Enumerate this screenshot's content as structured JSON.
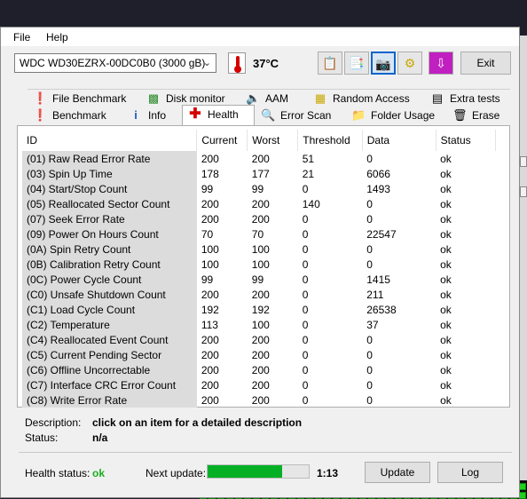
{
  "menu": {
    "file": "File",
    "help": "Help"
  },
  "toolbar": {
    "drive": "WDC WD30EZRX-00DC0B0 (3000 gB)",
    "temperature": "37°C",
    "exit": "Exit"
  },
  "tabs_row1": [
    {
      "label": "File Benchmark",
      "icon": "info-icon"
    },
    {
      "label": "Disk monitor",
      "icon": "chart-icon"
    },
    {
      "label": "AAM",
      "icon": "speaker-icon"
    },
    {
      "label": "Random Access",
      "icon": "grid-icon"
    },
    {
      "label": "Extra tests",
      "icon": "table-icon"
    }
  ],
  "tabs_row2": [
    {
      "label": "Benchmark",
      "icon": "bulb-icon"
    },
    {
      "label": "Info",
      "icon": "info-icon"
    },
    {
      "label": "Health",
      "icon": "cross-icon"
    },
    {
      "label": "Error Scan",
      "icon": "search-icon"
    },
    {
      "label": "Folder Usage",
      "icon": "folder-icon"
    },
    {
      "label": "Erase",
      "icon": "trash-icon"
    }
  ],
  "table": {
    "headers": [
      "ID",
      "Current",
      "Worst",
      "Threshold",
      "Data",
      "Status"
    ],
    "rows": [
      [
        "(01) Raw Read Error Rate",
        "200",
        "200",
        "51",
        "0",
        "ok"
      ],
      [
        "(03) Spin Up Time",
        "178",
        "177",
        "21",
        "6066",
        "ok"
      ],
      [
        "(04) Start/Stop Count",
        "99",
        "99",
        "0",
        "1493",
        "ok"
      ],
      [
        "(05) Reallocated Sector Count",
        "200",
        "200",
        "140",
        "0",
        "ok"
      ],
      [
        "(07) Seek Error Rate",
        "200",
        "200",
        "0",
        "0",
        "ok"
      ],
      [
        "(09) Power On Hours Count",
        "70",
        "70",
        "0",
        "22547",
        "ok"
      ],
      [
        "(0A) Spin Retry Count",
        "100",
        "100",
        "0",
        "0",
        "ok"
      ],
      [
        "(0B) Calibration Retry Count",
        "100",
        "100",
        "0",
        "0",
        "ok"
      ],
      [
        "(0C) Power Cycle Count",
        "99",
        "99",
        "0",
        "1415",
        "ok"
      ],
      [
        "(C0) Unsafe Shutdown Count",
        "200",
        "200",
        "0",
        "211",
        "ok"
      ],
      [
        "(C1) Load Cycle Count",
        "192",
        "192",
        "0",
        "26538",
        "ok"
      ],
      [
        "(C2) Temperature",
        "113",
        "100",
        "0",
        "37",
        "ok"
      ],
      [
        "(C4) Reallocated Event Count",
        "200",
        "200",
        "0",
        "0",
        "ok"
      ],
      [
        "(C5) Current Pending Sector",
        "200",
        "200",
        "0",
        "0",
        "ok"
      ],
      [
        "(C6) Offline Uncorrectable",
        "200",
        "200",
        "0",
        "0",
        "ok"
      ],
      [
        "(C7) Interface CRC Error Count",
        "200",
        "200",
        "0",
        "0",
        "ok"
      ],
      [
        "(C8) Write Error Rate",
        "200",
        "200",
        "0",
        "0",
        "ok"
      ]
    ]
  },
  "description": {
    "label": "Description:",
    "value": "click on an item for a detailed description"
  },
  "status": {
    "label": "Status:",
    "value": "n/a"
  },
  "footer": {
    "health_label": "Health status:",
    "health_value": "ok",
    "next_update_label": "Next update:",
    "progress_fraction": 0.74,
    "time": "1:13",
    "update": "Update",
    "log": "Log"
  },
  "colors": {
    "health_ok": "#1fae1f",
    "progress": "#06b025",
    "active_tab_icon": "#d40000"
  }
}
